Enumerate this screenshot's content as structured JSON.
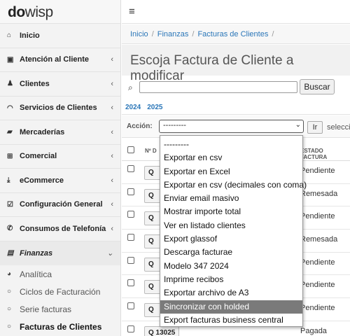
{
  "logo": {
    "bold": "do",
    "light": "wisp"
  },
  "sidebar": {
    "items": [
      {
        "icon": "home-icon",
        "glyph": "⌂",
        "label": "Inicio",
        "chevron": ""
      },
      {
        "icon": "calendar-icon",
        "glyph": "▣",
        "label": "Atención al Cliente",
        "chevron": "‹"
      },
      {
        "icon": "users-icon",
        "glyph": "♟",
        "label": "Clientes",
        "chevron": "‹"
      },
      {
        "icon": "wifi-icon",
        "glyph": "◠",
        "label": "Servicios de Clientes",
        "chevron": "‹"
      },
      {
        "icon": "truck-icon",
        "glyph": "▰",
        "label": "Mercaderías",
        "chevron": "‹"
      },
      {
        "icon": "cart-icon",
        "glyph": "⊞",
        "label": "Comercial",
        "chevron": "‹"
      },
      {
        "icon": "download-icon",
        "glyph": "⤓",
        "label": "eCommerce",
        "chevron": "‹"
      },
      {
        "icon": "checkbox-icon",
        "glyph": "☑",
        "label": "Configuración General",
        "chevron": "‹"
      },
      {
        "icon": "phone-icon",
        "glyph": "✆",
        "label": "Consumos de Telefonía",
        "chevron": "‹"
      },
      {
        "icon": "money-icon",
        "glyph": "▤",
        "label": "Finanzas",
        "chevron": "⌄"
      }
    ],
    "sub": [
      {
        "icon": "pie-chart-icon",
        "glyph": "◕",
        "label": "Analítica"
      },
      {
        "icon": "circle-icon",
        "glyph": "○",
        "label": "Ciclos de Facturación"
      },
      {
        "icon": "circle-icon",
        "glyph": "○",
        "label": "Serie facturas"
      },
      {
        "icon": "circle-icon",
        "glyph": "○",
        "label": "Facturas de Clientes"
      }
    ]
  },
  "topbar": {
    "menu_glyph": "≡"
  },
  "breadcrumb": [
    "Inicio",
    "Finanzas",
    "Facturas de Clientes"
  ],
  "breadcrumb_sep": "/",
  "title": "Escoja Factura de Cliente a modificar",
  "search": {
    "value": "",
    "button": "Buscar",
    "glyph": "🔍"
  },
  "years": [
    "2024",
    "2025"
  ],
  "action": {
    "label": "Acción:",
    "selected": "---------",
    "go": "Ir",
    "info": "seleccio"
  },
  "table": {
    "headers": [
      "Nº D",
      "ESTADO FACTURA"
    ],
    "rows": [
      {
        "num": "Q",
        "estado": "Pendiente"
      },
      {
        "num": "Q",
        "estado": "Remesada"
      },
      {
        "num": "Q",
        "estado": "Pendiente"
      },
      {
        "num": "Q",
        "estado": "Remesada"
      },
      {
        "num": "Q",
        "estado": "Pendiente"
      },
      {
        "num": "Q",
        "estado": "Pendiente"
      },
      {
        "num": "Q",
        "estado": "Pendiente"
      },
      {
        "num": "Q 13025",
        "estado": "Pagada"
      }
    ]
  },
  "dropdown": {
    "options": [
      "---------",
      "Exportar en csv",
      "Exportar en Excel",
      "Exportar en csv (decimales con coma)",
      "Enviar email masivo",
      "Mostrar importe total",
      "Ver en listado clientes",
      "Export glassof",
      "Descarga facturae",
      "Modelo 347 2024",
      "Imprime recibos",
      "Exportar archivo de A3",
      "Sincronizar con holded",
      "Export facturas business central"
    ],
    "highlighted": "Sincronizar con holded"
  }
}
